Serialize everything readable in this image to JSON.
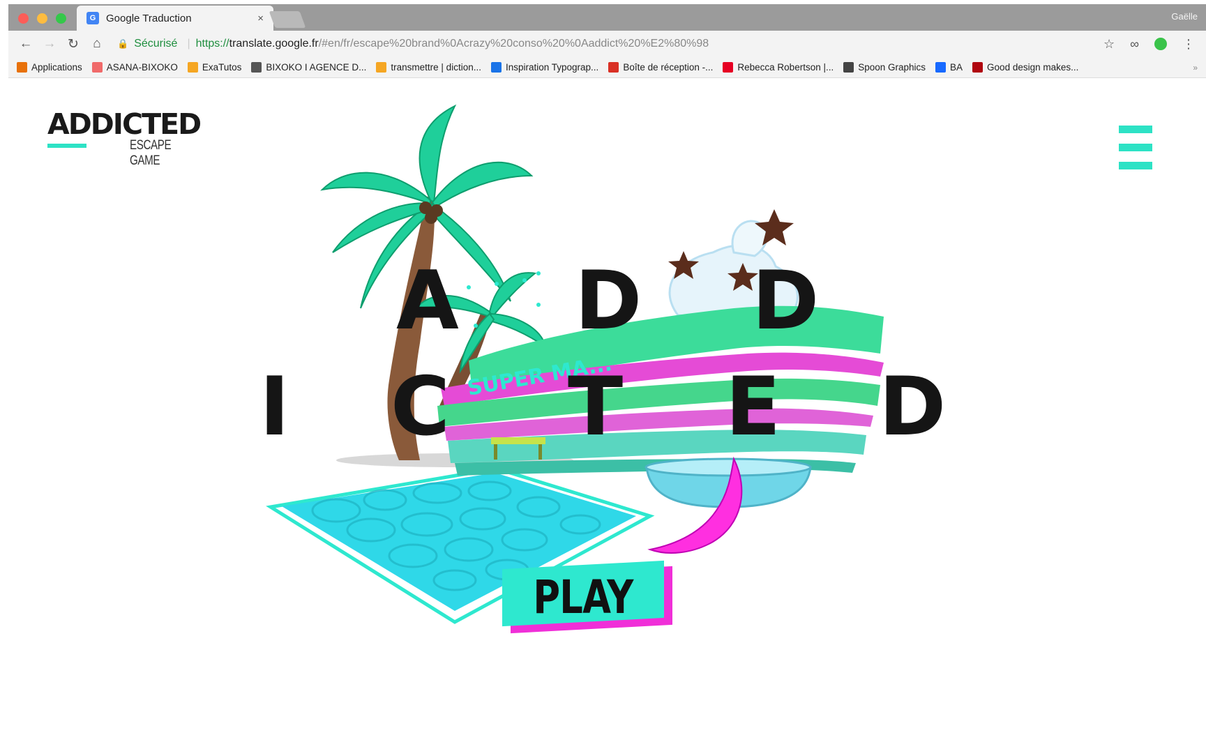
{
  "browser": {
    "tab_title": "Google Traduction",
    "tab_close": "×",
    "tab_favicon": "G",
    "profile_name": "Gaëlle",
    "secure_label": "Sécurisé",
    "url_scheme": "https://",
    "url_host": "translate.google.fr",
    "url_path": "/#en/fr/escape%20brand%0Acrazy%20conso%20%0Aaddict%20%E2%80%98",
    "icons": [
      "back-icon",
      "forward-icon",
      "reload-icon",
      "home-icon",
      "lock-icon",
      "star-icon",
      "extension-icon",
      "menu-dots-icon"
    ]
  },
  "bookmarks": [
    {
      "label": "Applications",
      "icon": "apps-grid-icon",
      "color": "#e8710a"
    },
    {
      "label": "ASANA-BIXOKO",
      "icon": "asana-icon",
      "color": "#f06a6a"
    },
    {
      "label": "ExaTutos",
      "icon": "exatutos-icon",
      "color": "#f5a623"
    },
    {
      "label": "BIXOKO I AGENCE D...",
      "icon": "bixoko-icon",
      "color": "#555555"
    },
    {
      "label": "transmettre | diction...",
      "icon": "dictionary-icon",
      "color": "#f5a623"
    },
    {
      "label": "Inspiration Typograp...",
      "icon": "inspiration-icon",
      "color": "#1a73e8"
    },
    {
      "label": "Boîte de réception -...",
      "icon": "gmail-icon",
      "color": "#d93025"
    },
    {
      "label": "Rebecca Robertson |...",
      "icon": "pinterest-icon",
      "color": "#e60023"
    },
    {
      "label": "Spoon Graphics",
      "icon": "spoon-graphics-icon",
      "color": "#444444"
    },
    {
      "label": "BA",
      "icon": "behance-icon",
      "color": "#1769ff"
    },
    {
      "label": "Good design makes...",
      "icon": "adobe-icon",
      "color": "#b0060f"
    }
  ],
  "bookmarks_more": "»",
  "site": {
    "logo_word": "ADDICTED",
    "logo_sub": "ESCAPE GAME",
    "accent": "#2de2c5",
    "magenta": "#f02fd8",
    "hero_line1": [
      "A",
      "D",
      "D"
    ],
    "hero_line2": [
      "I",
      "C",
      "T",
      "E",
      "D"
    ],
    "sign_text": "SUPER MA...",
    "play_label": "PLAY"
  }
}
